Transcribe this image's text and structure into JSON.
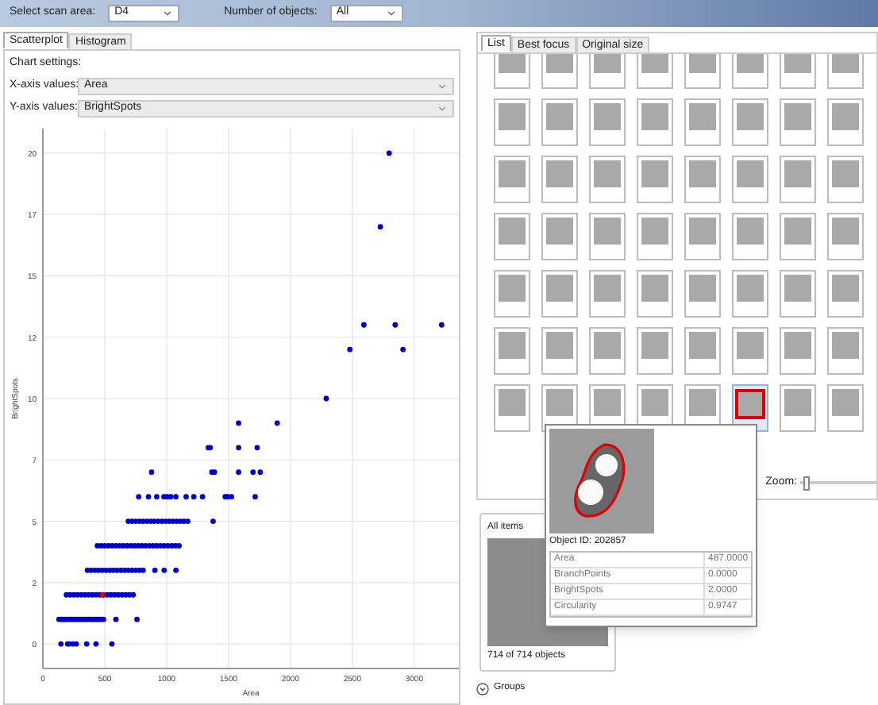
{
  "toolbar": {
    "scan_area": {
      "label": "Select scan area:",
      "value": "D4"
    },
    "objects": {
      "label": "Number of objects:",
      "value": "All"
    }
  },
  "left_tabs": [
    {
      "label": "Scatterplot",
      "selected": true
    },
    {
      "label": "Histogram",
      "selected": false
    }
  ],
  "chart_settings": {
    "title": "Chart settings:",
    "x_axis": {
      "label": "X-axis values:",
      "value": "Area"
    },
    "y_axis": {
      "label": "Y-axis values:",
      "value": "BrightSpots"
    }
  },
  "chart_data": {
    "type": "scatter",
    "grid": true,
    "xlabel": "Area",
    "ylabel": "BrightSpots",
    "xlim": [
      0,
      3360
    ],
    "ylim": [
      -1,
      21
    ],
    "xticks": [
      0,
      500,
      1000,
      1500,
      2000,
      2500,
      3000
    ],
    "yticks": [
      {
        "value": 0,
        "label": "0"
      },
      {
        "value": 2.5,
        "label": "2"
      },
      {
        "value": 5,
        "label": "5"
      },
      {
        "value": 7.5,
        "label": "7"
      },
      {
        "value": 10,
        "label": "10"
      },
      {
        "value": 12.5,
        "label": "12"
      },
      {
        "value": 15,
        "label": "15"
      },
      {
        "value": 17.5,
        "label": "17"
      },
      {
        "value": 20,
        "label": "20"
      }
    ],
    "series": [
      {
        "color": "#0000cc",
        "x": [
          146,
          200,
          212,
          241,
          270,
          354,
          429,
          558,
          130,
          150,
          170,
          190,
          210,
          230,
          250,
          270,
          290,
          310,
          330,
          350,
          370,
          390,
          410,
          430,
          450,
          470,
          490,
          590,
          760,
          190,
          220,
          250,
          280,
          310,
          340,
          370,
          400,
          430,
          460,
          490,
          520,
          550,
          580,
          610,
          640,
          670,
          700,
          730,
          360,
          390,
          420,
          450,
          480,
          510,
          540,
          570,
          600,
          630,
          660,
          690,
          720,
          750,
          780,
          810,
          905,
          980,
          1075,
          440,
          470,
          500,
          530,
          560,
          590,
          620,
          650,
          680,
          710,
          740,
          770,
          800,
          830,
          860,
          890,
          920,
          950,
          980,
          1010,
          1040,
          1070,
          1100,
          690,
          720,
          750,
          780,
          810,
          840,
          870,
          900,
          930,
          960,
          990,
          1020,
          1050,
          1080,
          1110,
          1140,
          1170,
          1375,
          774,
          853,
          920,
          978,
          1003,
          1032,
          1074,
          1157,
          1219,
          1290,
          1473,
          1490,
          1523,
          1715,
          878,
          1365,
          1386,
          1581,
          1698,
          1756,
          1336,
          1352,
          1581,
          1731,
          1581,
          1893,
          2289,
          2480,
          2909,
          2593,
          2846,
          3221,
          2726,
          2797
        ],
        "values": [
          0,
          0,
          0,
          0,
          0,
          0,
          0,
          0,
          1,
          1,
          1,
          1,
          1,
          1,
          1,
          1,
          1,
          1,
          1,
          1,
          1,
          1,
          1,
          1,
          1,
          1,
          1,
          1,
          1,
          2,
          2,
          2,
          2,
          2,
          2,
          2,
          2,
          2,
          2,
          2,
          2,
          2,
          2,
          2,
          2,
          2,
          2,
          2,
          3,
          3,
          3,
          3,
          3,
          3,
          3,
          3,
          3,
          3,
          3,
          3,
          3,
          3,
          3,
          3,
          3,
          3,
          3,
          4,
          4,
          4,
          4,
          4,
          4,
          4,
          4,
          4,
          4,
          4,
          4,
          4,
          4,
          4,
          4,
          4,
          4,
          4,
          4,
          4,
          4,
          4,
          5,
          5,
          5,
          5,
          5,
          5,
          5,
          5,
          5,
          5,
          5,
          5,
          5,
          5,
          5,
          5,
          5,
          5,
          6,
          6,
          6,
          6,
          6,
          6,
          6,
          6,
          6,
          6,
          6,
          6,
          6,
          6,
          7,
          7,
          7,
          7,
          7,
          7,
          8,
          8,
          8,
          8,
          9,
          9,
          10,
          12,
          12,
          13,
          13,
          13,
          17,
          20
        ]
      },
      {
        "color": "#dd0000",
        "x": [
          483
        ],
        "values": [
          2
        ]
      }
    ]
  },
  "right_tabs": [
    {
      "label": "List",
      "selected": true
    },
    {
      "label": "Best focus",
      "selected": false
    },
    {
      "label": "Original size",
      "selected": false
    }
  ],
  "gallery": {
    "rows": [
      {
        "thumbnails": [
          {
            "selected": false
          },
          {
            "selected": false
          },
          {
            "selected": false
          },
          {
            "selected": false
          },
          {
            "selected": false
          },
          {
            "selected": false
          },
          {
            "selected": false
          },
          {
            "selected": false
          }
        ]
      },
      {
        "thumbnails": [
          {
            "selected": false
          },
          {
            "selected": false
          },
          {
            "selected": false
          },
          {
            "selected": false
          },
          {
            "selected": false
          },
          {
            "selected": false
          },
          {
            "selected": false
          },
          {
            "selected": false
          }
        ]
      },
      {
        "thumbnails": [
          {
            "selected": false
          },
          {
            "selected": false
          },
          {
            "selected": false
          },
          {
            "selected": false
          },
          {
            "selected": false
          },
          {
            "selected": false
          },
          {
            "selected": false
          },
          {
            "selected": false
          }
        ]
      },
      {
        "thumbnails": [
          {
            "selected": false
          },
          {
            "selected": false
          },
          {
            "selected": false
          },
          {
            "selected": false
          },
          {
            "selected": false
          },
          {
            "selected": false
          },
          {
            "selected": false
          },
          {
            "selected": false
          }
        ]
      },
      {
        "thumbnails": [
          {
            "selected": false
          },
          {
            "selected": false
          },
          {
            "selected": false
          },
          {
            "selected": false
          },
          {
            "selected": false
          },
          {
            "selected": false
          },
          {
            "selected": false
          },
          {
            "selected": false
          }
        ]
      },
      {
        "thumbnails": [
          {
            "selected": false
          },
          {
            "selected": false
          },
          {
            "selected": false
          },
          {
            "selected": false
          },
          {
            "selected": false
          },
          {
            "selected": false
          },
          {
            "selected": false
          },
          {
            "selected": false
          }
        ]
      },
      {
        "thumbnails": [
          {
            "selected": false
          },
          {
            "selected": false
          },
          {
            "selected": false
          },
          {
            "selected": false
          },
          {
            "selected": false
          },
          {
            "selected": true
          },
          {
            "selected": false
          },
          {
            "selected": false
          }
        ]
      }
    ],
    "zoom": {
      "label": "Zoom:",
      "level": 0.05
    }
  },
  "items_card": {
    "title": "All items",
    "count": "714 of 714 objects"
  },
  "groups": {
    "label": "Groups"
  },
  "tooltip": {
    "object_id": "Object ID: 202857",
    "properties": [
      {
        "name": "Area",
        "value": "487.0000"
      },
      {
        "name": "BranchPoints",
        "value": "0.0000"
      },
      {
        "name": "BrightSpots",
        "value": "2.0000"
      },
      {
        "name": "Circularity",
        "value": "0.9747"
      }
    ]
  }
}
